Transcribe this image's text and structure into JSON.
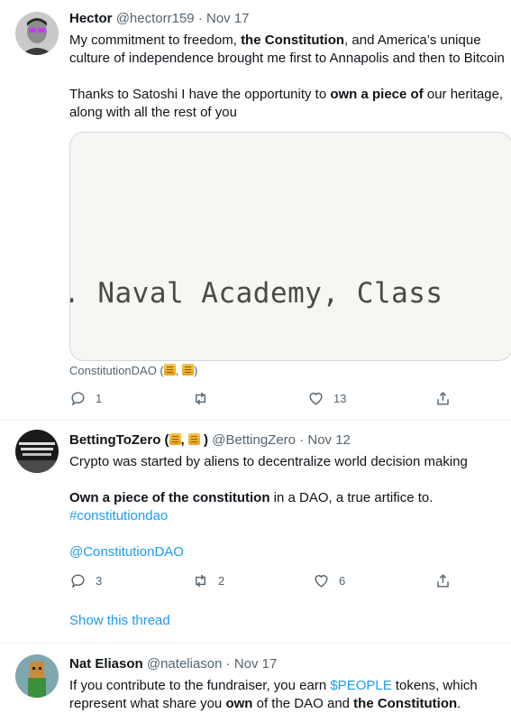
{
  "tweets": [
    {
      "name": "Hector",
      "handle": "@hectorr159",
      "sep": "·",
      "date": "Nov 17",
      "lines": [
        [
          {
            "t": "My commitment to freedom, "
          },
          {
            "t": "the Constitution",
            "b": true
          },
          {
            "t": ", and America’s unique"
          }
        ],
        [
          {
            "t": "culture of independence brought me first to Annapolis and then to Bitcoin"
          }
        ],
        [],
        [
          {
            "t": "Thanks to Satoshi I have the opportunity to "
          },
          {
            "t": "own a piece of",
            "b": true
          },
          {
            "t": " our heritage,"
          }
        ],
        [
          {
            "t": "along with all the rest of you"
          }
        ]
      ],
      "media_text": ". Naval Academy, Class",
      "card_source": "ConstitutionDAO (",
      "card_source_sep": ", ",
      "card_source_end": ")",
      "actions": {
        "reply": "1",
        "retweet": "",
        "like": "13"
      }
    },
    {
      "name": "BettingToZero (",
      "name_sep": ", ",
      "name_end": " )",
      "handle": "@BettingZero",
      "sep": "·",
      "date": "Nov 12",
      "avatar_text": "IT'LL BE THE BEST YOU MUST BE A REALLY",
      "lines": [
        [
          {
            "t": "Crypto was started by aliens to decentralize world decision making"
          }
        ],
        [],
        [
          {
            "t": "Own a piece of the constitution",
            "b": true
          },
          {
            "t": " in a DAO, a true artifice to."
          }
        ],
        [
          {
            "t": "#constitutiondao",
            "link": true
          }
        ],
        [],
        [
          {
            "t": "@ConstitutionDAO",
            "link": true
          }
        ]
      ],
      "actions": {
        "reply": "3",
        "retweet": "2",
        "like": "6"
      },
      "show_thread": "Show this thread"
    },
    {
      "name": "Nat Eliason",
      "handle": "@nateliason",
      "sep": "·",
      "date": "Nov 17",
      "lines": [
        [
          {
            "t": "If you contribute to the fundraiser, you earn "
          },
          {
            "t": "$PEOPLE",
            "link": true
          },
          {
            "t": " tokens, which"
          }
        ],
        [
          {
            "t": "represent what share you "
          },
          {
            "t": "own",
            "b": true
          },
          {
            "t": " of the DAO and "
          },
          {
            "t": "the Constitution",
            "b": true
          },
          {
            "t": "."
          }
        ]
      ]
    }
  ],
  "colors": {
    "link": "#1d9bf0",
    "muted": "#536471",
    "text": "#0f1419"
  },
  "icons": [
    "reply-icon",
    "retweet-icon",
    "like-icon",
    "share-icon",
    "scroll-emoji-icon"
  ]
}
